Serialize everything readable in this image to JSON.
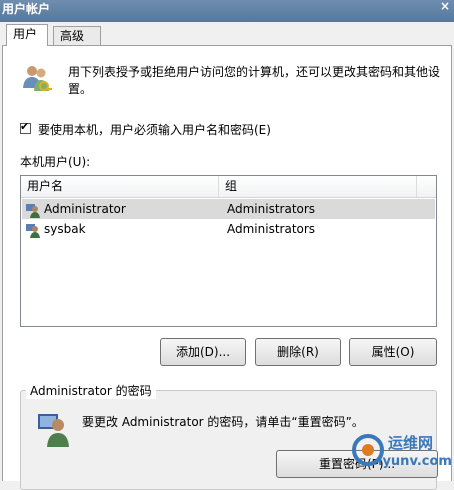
{
  "window": {
    "title": "用户帐户"
  },
  "tabs": [
    {
      "label": "用户"
    },
    {
      "label": "高级"
    }
  ],
  "description": "用下列表授予或拒绝用户访问您的计算机，还可以更改其密码和其他设置。",
  "require_login": {
    "label": "要使用本机，用户必须输入用户名和密码(E)",
    "checked": true
  },
  "local_users": {
    "label": "本机用户(U):",
    "columns": [
      "用户名",
      "组"
    ],
    "rows": [
      {
        "name": "Administrator",
        "group": "Administrators",
        "selected": true
      },
      {
        "name": "sysbak",
        "group": "Administrators",
        "selected": false
      }
    ]
  },
  "buttons": {
    "add": "添加(D)...",
    "remove": "删除(R)",
    "properties": "属性(O)"
  },
  "password_group": {
    "title": "Administrator 的密码",
    "text": "要更改 Administrator 的密码，请单击“重置密码”。",
    "reset_button": "重置密码(P)..."
  },
  "watermark": {
    "cn": "运维网",
    "en": "iyunv.com"
  },
  "icons": {
    "close": "close-icon",
    "users": "users-icon",
    "user": "user-icon",
    "password": "user-password-icon"
  }
}
